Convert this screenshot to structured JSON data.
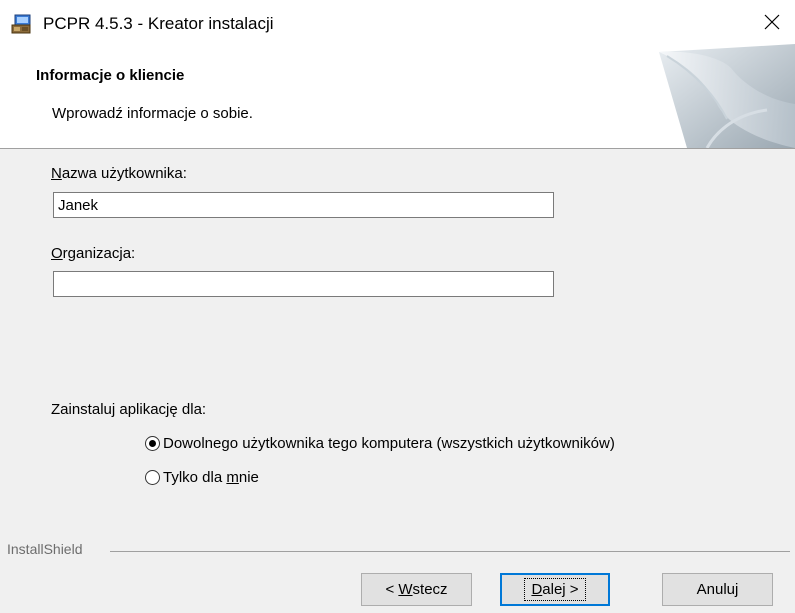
{
  "window": {
    "title": "PCPR 4.5.3 - Kreator instalacji",
    "close_glyph": "×"
  },
  "header": {
    "title": "Informacje o kliencie",
    "subtitle": "Wprowadź informacje o sobie."
  },
  "form": {
    "username": {
      "label_hotkey": "N",
      "label_rest": "azwa użytkownika:",
      "value": "Janek"
    },
    "organization": {
      "label_hotkey": "O",
      "label_rest": "rganizacja:",
      "value": ""
    },
    "install_for": {
      "label": "Zainstaluj aplikację dla:",
      "options": [
        {
          "label": "Dowolnego użytkownika tego komputera (wszystkich użytkowników)",
          "selected": true
        },
        {
          "label_prefix": "Tylko dla ",
          "label_hotkey": "m",
          "label_suffix": "nie",
          "selected": false
        }
      ]
    }
  },
  "footer": {
    "brand": "InstallShield",
    "buttons": {
      "back_prefix": "< ",
      "back_hotkey": "W",
      "back_suffix": "stecz",
      "next_hotkey": "D",
      "next_suffix": "alej >",
      "cancel": "Anuluj"
    }
  },
  "colors": {
    "accent": "#0078d7",
    "dialog_bg": "#f0f0f0",
    "header_bg": "#ffffff"
  }
}
